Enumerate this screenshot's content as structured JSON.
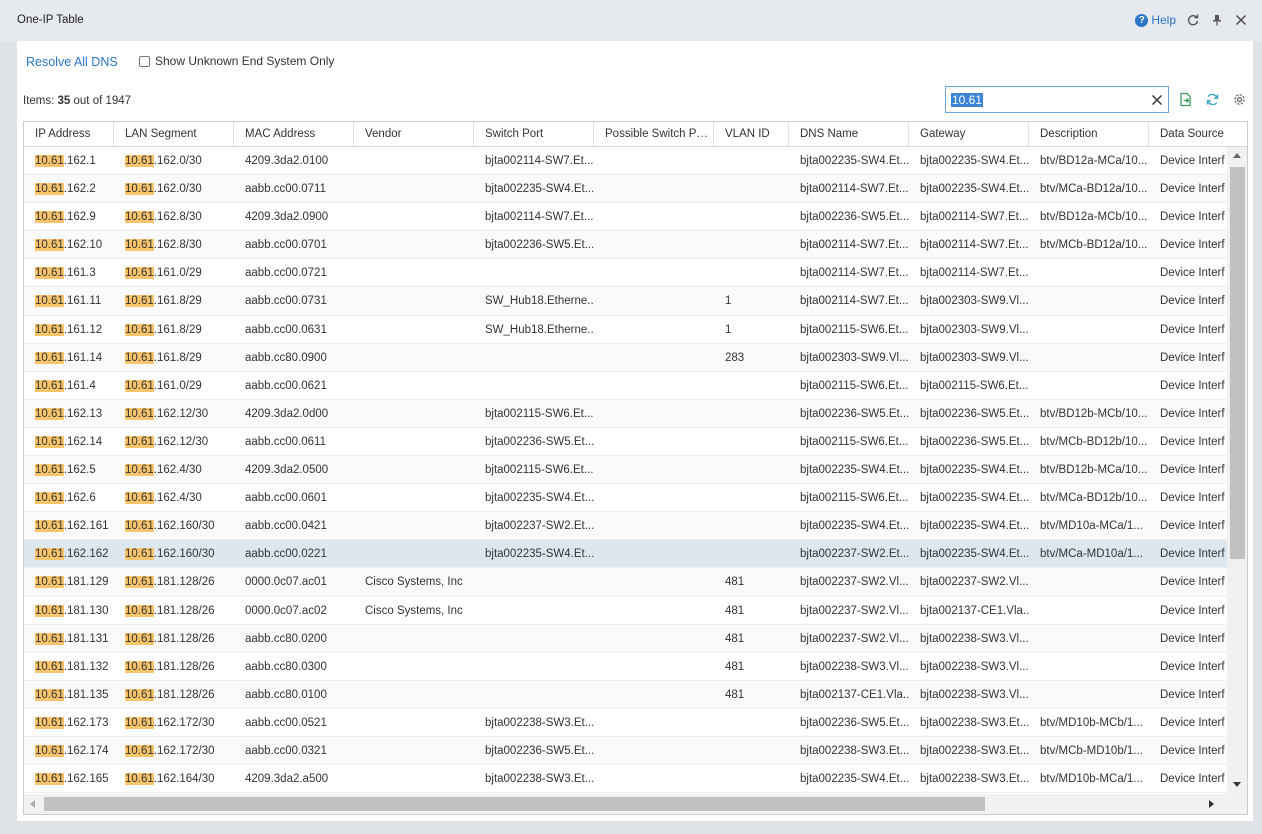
{
  "window": {
    "title": "One-IP Table",
    "help_label": "Help"
  },
  "toolbar": {
    "resolve_label": "Resolve All DNS",
    "unknown_label": "Show Unknown End System Only"
  },
  "items": {
    "prefix": "Items: ",
    "count": "35",
    "suffix": " out of 1947"
  },
  "search": {
    "value": "10.61"
  },
  "columns": [
    "IP Address",
    "LAN Segment",
    "MAC Address",
    "Vendor",
    "Switch Port",
    "Possible Switch Por...",
    "VLAN ID",
    "DNS Name",
    "Gateway",
    "Description",
    "Data Source"
  ],
  "rows": [
    [
      "10.61.162.1",
      "10.61.162.0/30",
      "4209.3da2.0100",
      "",
      "bjta002114-SW7.Et...",
      "",
      "",
      "bjta002235-SW4.Et...",
      "bjta002235-SW4.Et...",
      "btv/BD12a-MCa/10...",
      "Device Interf"
    ],
    [
      "10.61.162.2",
      "10.61.162.0/30",
      "aabb.cc00.0711",
      "",
      "bjta002235-SW4.Et...",
      "",
      "",
      "bjta002114-SW7.Et...",
      "bjta002235-SW4.Et...",
      "btv/MCa-BD12a/10...",
      "Device Interf"
    ],
    [
      "10.61.162.9",
      "10.61.162.8/30",
      "4209.3da2.0900",
      "",
      "bjta002114-SW7.Et...",
      "",
      "",
      "bjta002236-SW5.Et...",
      "bjta002114-SW7.Et...",
      "btv/BD12a-MCb/10...",
      "Device Interf"
    ],
    [
      "10.61.162.10",
      "10.61.162.8/30",
      "aabb.cc00.0701",
      "",
      "bjta002236-SW5.Et...",
      "",
      "",
      "bjta002114-SW7.Et...",
      "bjta002114-SW7.Et...",
      "btv/MCb-BD12a/10...",
      "Device Interf"
    ],
    [
      "10.61.161.3",
      "10.61.161.0/29",
      "aabb.cc00.0721",
      "",
      "",
      "",
      "",
      "bjta002114-SW7.Et...",
      "bjta002114-SW7.Et...",
      "",
      "Device Interf"
    ],
    [
      "10.61.161.11",
      "10.61.161.8/29",
      "aabb.cc00.0731",
      "",
      "SW_Hub18.Etherne...",
      "",
      "1",
      "bjta002114-SW7.Et...",
      "bjta002303-SW9.Vl...",
      "",
      "Device Interf"
    ],
    [
      "10.61.161.12",
      "10.61.161.8/29",
      "aabb.cc00.0631",
      "",
      "SW_Hub18.Etherne...",
      "",
      "1",
      "bjta002115-SW6.Et...",
      "bjta002303-SW9.Vl...",
      "",
      "Device Interf"
    ],
    [
      "10.61.161.14",
      "10.61.161.8/29",
      "aabb.cc80.0900",
      "",
      "",
      "",
      "283",
      "bjta002303-SW9.Vl...",
      "bjta002303-SW9.Vl...",
      "",
      "Device Interf"
    ],
    [
      "10.61.161.4",
      "10.61.161.0/29",
      "aabb.cc00.0621",
      "",
      "",
      "",
      "",
      "bjta002115-SW6.Et...",
      "bjta002115-SW6.Et...",
      "",
      "Device Interf"
    ],
    [
      "10.61.162.13",
      "10.61.162.12/30",
      "4209.3da2.0d00",
      "",
      "bjta002115-SW6.Et...",
      "",
      "",
      "bjta002236-SW5.Et...",
      "bjta002236-SW5.Et...",
      "btv/BD12b-MCb/10...",
      "Device Interf"
    ],
    [
      "10.61.162.14",
      "10.61.162.12/30",
      "aabb.cc00.0611",
      "",
      "bjta002236-SW5.Et...",
      "",
      "",
      "bjta002115-SW6.Et...",
      "bjta002236-SW5.Et...",
      "btv/MCb-BD12b/10...",
      "Device Interf"
    ],
    [
      "10.61.162.5",
      "10.61.162.4/30",
      "4209.3da2.0500",
      "",
      "bjta002115-SW6.Et...",
      "",
      "",
      "bjta002235-SW4.Et...",
      "bjta002235-SW4.Et...",
      "btv/BD12b-MCa/10...",
      "Device Interf"
    ],
    [
      "10.61.162.6",
      "10.61.162.4/30",
      "aabb.cc00.0601",
      "",
      "bjta002235-SW4.Et...",
      "",
      "",
      "bjta002115-SW6.Et...",
      "bjta002235-SW4.Et...",
      "btv/MCa-BD12b/10...",
      "Device Interf"
    ],
    [
      "10.61.162.161",
      "10.61.162.160/30",
      "aabb.cc00.0421",
      "",
      "bjta002237-SW2.Et...",
      "",
      "",
      "bjta002235-SW4.Et...",
      "bjta002235-SW4.Et...",
      "btv/MD10a-MCa/1...",
      "Device Interf"
    ],
    [
      "10.61.162.162",
      "10.61.162.160/30",
      "aabb.cc00.0221",
      "",
      "bjta002235-SW4.Et...",
      "",
      "",
      "bjta002237-SW2.Et...",
      "bjta002235-SW4.Et...",
      "btv/MCa-MD10a/1...",
      "Device Interf"
    ],
    [
      "10.61.181.129",
      "10.61.181.128/26",
      "0000.0c07.ac01",
      "Cisco Systems, Inc",
      "",
      "",
      "481",
      "bjta002237-SW2.Vl...",
      "bjta002237-SW2.Vl...",
      "",
      "Device Interf"
    ],
    [
      "10.61.181.130",
      "10.61.181.128/26",
      "0000.0c07.ac02",
      "Cisco Systems, Inc",
      "",
      "",
      "481",
      "bjta002237-SW2.Vl...",
      "bjta002137-CE1.Vla...",
      "",
      "Device Interf"
    ],
    [
      "10.61.181.131",
      "10.61.181.128/26",
      "aabb.cc80.0200",
      "",
      "",
      "",
      "481",
      "bjta002237-SW2.Vl...",
      "bjta002238-SW3.Vl...",
      "",
      "Device Interf"
    ],
    [
      "10.61.181.132",
      "10.61.181.128/26",
      "aabb.cc80.0300",
      "",
      "",
      "",
      "481",
      "bjta002238-SW3.Vl...",
      "bjta002238-SW3.Vl...",
      "",
      "Device Interf"
    ],
    [
      "10.61.181.135",
      "10.61.181.128/26",
      "aabb.cc80.0100",
      "",
      "",
      "",
      "481",
      "bjta002137-CE1.Vla...",
      "bjta002238-SW3.Vl...",
      "",
      "Device Interf"
    ],
    [
      "10.61.162.173",
      "10.61.162.172/30",
      "aabb.cc00.0521",
      "",
      "bjta002238-SW3.Et...",
      "",
      "",
      "bjta002236-SW5.Et...",
      "bjta002238-SW3.Et...",
      "btv/MD10b-MCb/1...",
      "Device Interf"
    ],
    [
      "10.61.162.174",
      "10.61.162.172/30",
      "aabb.cc00.0321",
      "",
      "bjta002236-SW5.Et...",
      "",
      "",
      "bjta002238-SW3.Et...",
      "bjta002238-SW3.Et...",
      "btv/MCb-MD10b/1...",
      "Device Interf"
    ],
    [
      "10.61.162.165",
      "10.61.162.164/30",
      "4209.3da2.a500",
      "",
      "bjta002238-SW3.Et...",
      "",
      "",
      "bjta002235-SW4.Et...",
      "bjta002238-SW3.Et...",
      "btv/MD10b-MCa/1...",
      "Device Interf"
    ]
  ],
  "selected_row": 14,
  "highlight_color": "#f9c46b",
  "accent_color": "#2a76c6",
  "icons": {
    "help": "help-circle-icon",
    "refresh": "refresh-icon",
    "pin": "pin-icon",
    "close": "close-icon",
    "export": "export-icon",
    "sync": "sync-icon",
    "settings": "gear-icon"
  }
}
